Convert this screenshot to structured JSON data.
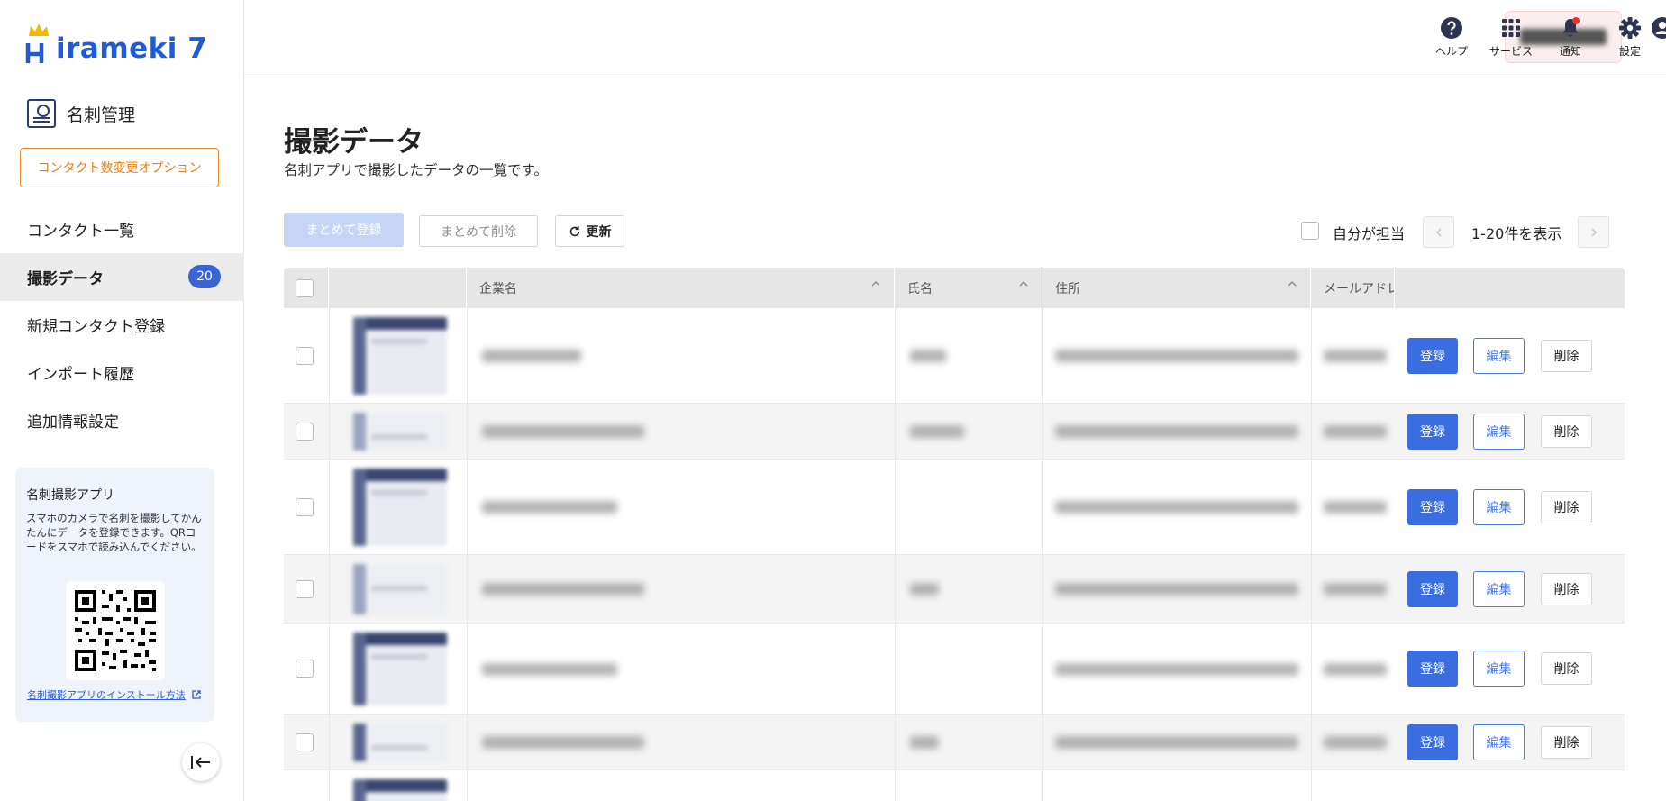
{
  "sidebar": {
    "logo": "irameki 7",
    "app_title": "名刺管理",
    "option_button": "コンタクト数変更オプション",
    "nav": [
      {
        "label": "コンタクト一覧"
      },
      {
        "label": "撮影データ",
        "badge": "20",
        "active": true
      },
      {
        "label": "新規コンタクト登録"
      },
      {
        "label": "インポート履歴"
      },
      {
        "label": "追加情報設定"
      }
    ],
    "promo": {
      "title": "名刺撮影アプリ",
      "text": "スマホのカメラで名刺を撮影してかんたんにデータを登録できます。QRコードをスマホで読み込んでください。",
      "link": "名刺撮影アプリのインストール方法"
    }
  },
  "header": {
    "help": "ヘルプ",
    "services": "サービス",
    "notifications": "通知",
    "settings": "設定"
  },
  "main": {
    "title": "撮影データ",
    "subtitle": "名刺アプリで撮影したデータの一覧です。",
    "bulk_register": "まとめて登録",
    "bulk_delete": "まとめて削除",
    "refresh": "更新",
    "self_assigned": "自分が担当",
    "pagination": "1-20件を表示"
  },
  "table": {
    "columns": {
      "company": "企業名",
      "name": "氏名",
      "address": "住所",
      "email": "メールアドレ"
    },
    "actions": {
      "register": "登録",
      "edit": "編集",
      "delete": "削除"
    }
  },
  "colors": {
    "accent": "#3a6ee0",
    "logo": "#1f5bd6",
    "option_orange": "#f08a24"
  }
}
